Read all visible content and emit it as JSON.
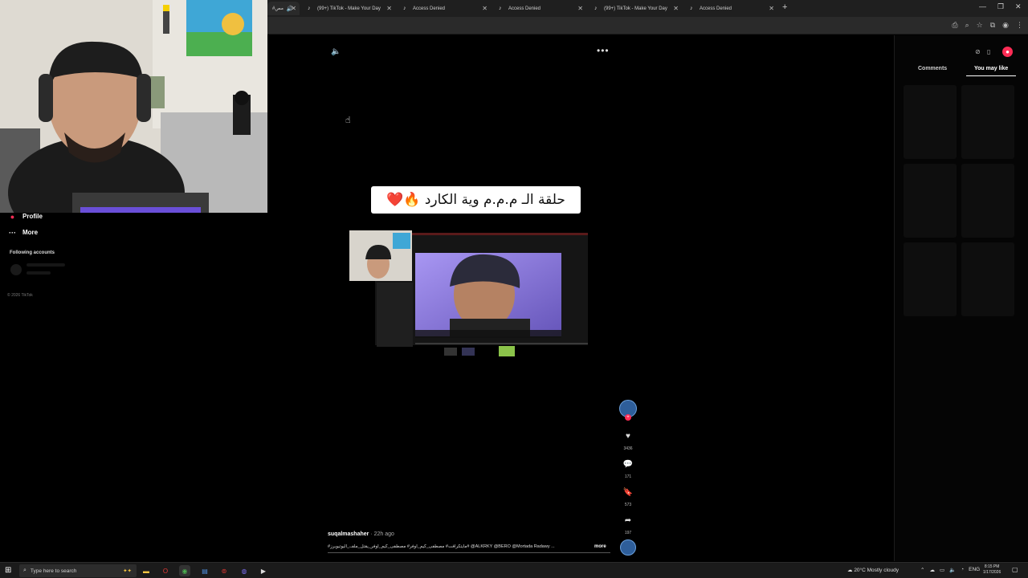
{
  "browser": {
    "tabs": [
      {
        "label": "#مص",
        "active": true
      },
      {
        "label": "(99+) TikTok - Make Your Day"
      },
      {
        "label": "Access Denied"
      },
      {
        "label": "Access Denied"
      },
      {
        "label": "(99+) TikTok - Make Your Day"
      },
      {
        "label": "Access Denied"
      }
    ]
  },
  "nav": {
    "profile": "Profile",
    "more": "More",
    "following_title": "Following accounts",
    "copyright": "© 2026 TikTok"
  },
  "video": {
    "caption": "حلقة الـ م.م.م وية الكارد 🔥❤️",
    "author": "suqalmashaher",
    "ago": "· 22h ago",
    "description": "#مايتكرافت# مصطفى_كيم_اوفر# مصطفى_كيم_اوفر_يقتل_ملف_اليوتيوبرز# @ALKRKY @BERO @Mortada Radawy ...",
    "more": "more"
  },
  "actions": {
    "likes": "3436",
    "comments": "171",
    "saves": "573",
    "shares": "197"
  },
  "right_panel": {
    "tab_comments": "Comments",
    "tab_you_may_like": "You may like"
  },
  "taskbar": {
    "search_placeholder": "Type here to search",
    "weather": "20°C  Mostly cloudy",
    "lang": "ENG",
    "time": "8:15 PM",
    "date": "1/17/2026"
  },
  "colors": {
    "accent_red": "#fe2c55",
    "background": "#000000"
  }
}
